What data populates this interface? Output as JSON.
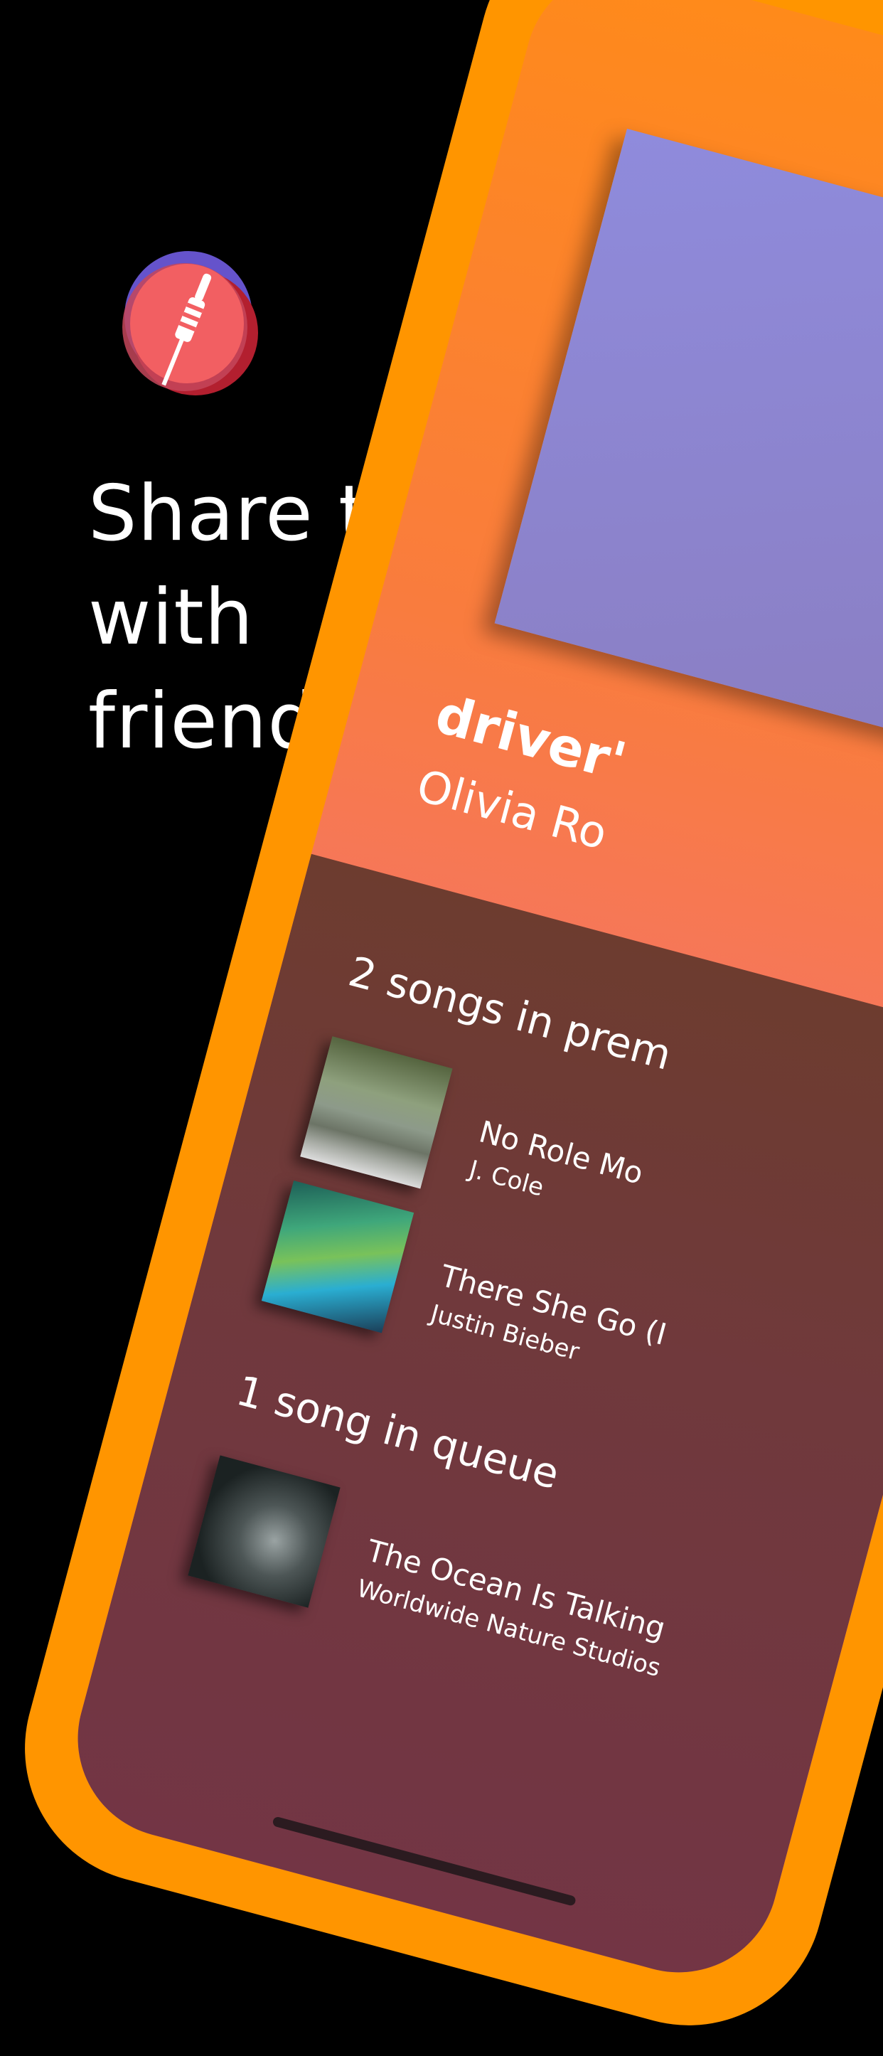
{
  "headline": {
    "line1": "Share the Aux",
    "line2": "with",
    "line3": "friends."
  },
  "logo": {
    "icon": "aux-cable-icon",
    "colors": [
      "#6a57d6",
      "#e25a5a",
      "#b31f2f",
      "#f25f62"
    ]
  },
  "colors": {
    "background": "#000000",
    "phone_frame": "#ff9500",
    "text": "#ffffff"
  },
  "now_playing": {
    "title": "driver'",
    "artist": "Olivia Ro"
  },
  "queue": {
    "premium_label": "2 songs in prem",
    "premium_tracks": [
      {
        "title": "No Role Mo",
        "artist": "J. Cole"
      },
      {
        "title": "There She Go (I",
        "artist": "Justin Bieber"
      }
    ],
    "queue_label": "1 song in queue",
    "queue_tracks": [
      {
        "title": "The Ocean Is Talking",
        "artist": "Worldwide Nature Studios"
      }
    ]
  }
}
